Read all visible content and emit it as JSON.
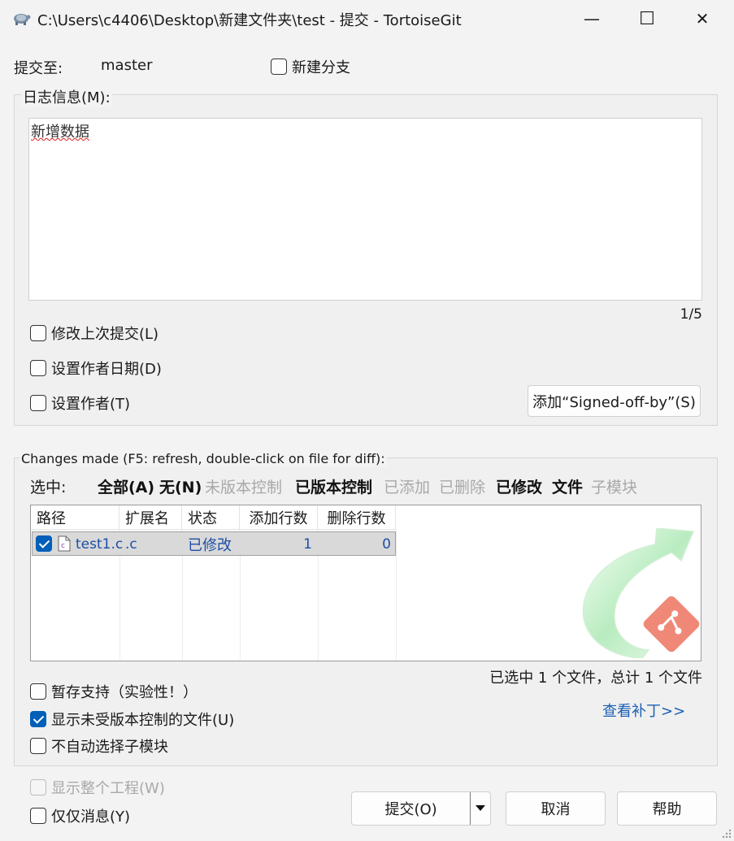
{
  "window": {
    "title": "C:\\Users\\c4406\\Desktop\\新建文件夹\\test - 提交 - TortoiseGit",
    "minimize_glyph": "—",
    "maximize_glyph": "☐",
    "close_glyph": "✕"
  },
  "commit_to": {
    "label": "提交至:",
    "branch": "master",
    "new_branch_label": "新建分支"
  },
  "log": {
    "group_label": "日志信息(M):",
    "message": "新增数据",
    "position": "1/5"
  },
  "options": {
    "amend_label": "修改上次提交(L)",
    "set_date_label": "设置作者日期(D)",
    "set_author_label": "设置作者(T)",
    "signed_off_button": "添加“Signed-off-by”(S)"
  },
  "changes": {
    "group_label": "Changes made (F5: refresh, double-click on file for diff):",
    "select_label": "选中:",
    "filters": [
      {
        "label": "全部(A)",
        "state": "bold"
      },
      {
        "label": "无(N)",
        "state": "bold"
      },
      {
        "label": "未版本控制",
        "state": "dim"
      },
      {
        "label": "已版本控制",
        "state": "bold"
      },
      {
        "label": "已添加",
        "state": "dim"
      },
      {
        "label": "已删除",
        "state": "dim"
      },
      {
        "label": "已修改",
        "state": "bold"
      },
      {
        "label": "文件",
        "state": "bold"
      },
      {
        "label": "子模块",
        "state": "dim"
      }
    ],
    "columns": [
      "路径",
      "扩展名",
      "状态",
      "添加行数",
      "删除行数"
    ],
    "rows": [
      {
        "path": "test1.c",
        "ext": ".c",
        "status": "已修改",
        "added": "1",
        "deleted": "0",
        "checked": true
      }
    ],
    "summary": "已选中 1 个文件，总计 1 个文件",
    "view_patch": "查看补丁>>"
  },
  "extra_options": {
    "stash_label": "暂存支持（实验性！）",
    "show_unversioned_label": "显示未受版本控制的文件(U)",
    "no_autoselect_submodules_label": "不自动选择子模块"
  },
  "footer": {
    "whole_project_label": "显示整个工程(W)",
    "message_only_label": "仅仅消息(Y)",
    "commit_button": "提交(O)",
    "cancel_button": "取消",
    "help_button": "帮助"
  },
  "colors": {
    "accent": "#005fb8",
    "link": "#1a5fb4",
    "dim": "#a8a8a8"
  }
}
